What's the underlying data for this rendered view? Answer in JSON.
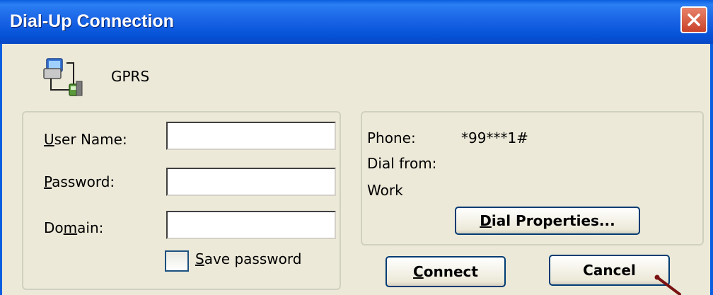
{
  "window": {
    "title": "Dial-Up Connection"
  },
  "connection": {
    "name": "GPRS"
  },
  "credentials": {
    "user_name_label_mnemonic": "U",
    "user_name_label_rest": "ser Name:",
    "password_label_mnemonic": "P",
    "password_label_rest": "assword:",
    "domain_label_pre": "Do",
    "domain_label_mnemonic": "m",
    "domain_label_post": "ain:",
    "user_name_value": "",
    "password_value": "",
    "domain_value": "",
    "save_password_mnemonic": "S",
    "save_password_rest": "ave password",
    "save_password_checked": false
  },
  "dial_info": {
    "phone_label": "Phone:",
    "phone_value": "*99***1#",
    "dial_from_label": "Dial from:",
    "location": "Work"
  },
  "buttons": {
    "dial_properties_mnemonic": "D",
    "dial_properties_rest": "ial Properties...",
    "connect_mnemonic": "C",
    "connect_rest": "onnect",
    "cancel": "Cancel"
  },
  "colors": {
    "titlebar": "#0653d8",
    "face": "#ece9d8",
    "close": "#c9422a"
  },
  "icons": {
    "connection": "network-computer-icon",
    "close": "close-icon",
    "cursor": "mouse-pointer-icon"
  }
}
